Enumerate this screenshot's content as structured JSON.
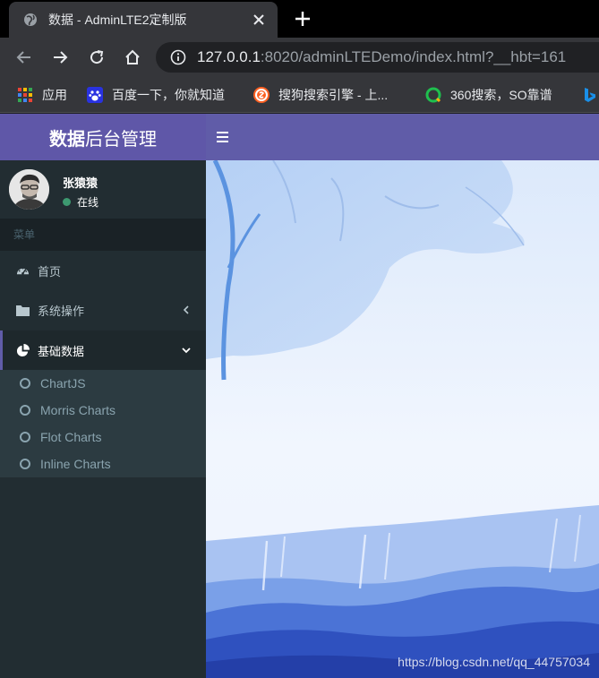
{
  "browser": {
    "tab_title": "数据 - AdminLTE2定制版",
    "url_host": "127.0.0.1",
    "url_rest": ":8020/adminLTEDemo/index.html?__hbt=161",
    "bookmarks": [
      {
        "label": "应用",
        "icon": "apps-grid-icon"
      },
      {
        "label": "百度一下，你就知道",
        "icon": "baidu-paw-icon"
      },
      {
        "label": "搜狗搜索引擎 - 上...",
        "icon": "sogou-icon"
      },
      {
        "label": "360搜索，SO靠谱",
        "icon": "360-search-icon"
      }
    ],
    "colors": {
      "tabbar": "#000000",
      "toolbar": "#35363a",
      "omnibox": "#202124"
    }
  },
  "app": {
    "logo_bold": "数据",
    "logo_light": "后台管理",
    "colors": {
      "header": "#605ca8",
      "sidebar": "#222d32",
      "submenu": "#2c3b41"
    }
  },
  "user": {
    "name": "张猿猿",
    "status": "在线",
    "status_color": "#3d9970"
  },
  "sidebar": {
    "header": "菜单",
    "items": [
      {
        "label": "首页",
        "icon": "dashboard-icon"
      },
      {
        "label": "系统操作",
        "icon": "folder-icon",
        "arrow": "chevron-left-icon"
      },
      {
        "label": "基础数据",
        "icon": "pie-chart-icon",
        "arrow": "chevron-down-icon",
        "active": true
      }
    ],
    "submenu": [
      {
        "label": "ChartJS"
      },
      {
        "label": "Morris Charts"
      },
      {
        "label": "Flot Charts"
      },
      {
        "label": "Inline Charts"
      }
    ]
  },
  "content": {
    "watermark": "https://blog.csdn.net/qq_44757034"
  }
}
